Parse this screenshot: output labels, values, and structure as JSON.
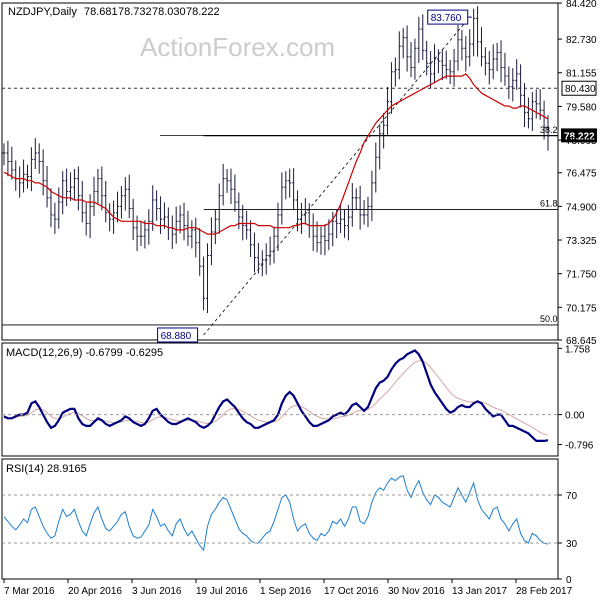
{
  "chart_data": [
    {
      "type": "line",
      "panel": "price",
      "symbol_label": "NZDJPY,Daily",
      "ohlc": [
        "78.681",
        "78.732",
        "78.030",
        "78.222"
      ],
      "watermark": "ActionForex.com",
      "ylim": [
        68.645,
        84.42
      ],
      "y_ticks": [
        "84.420",
        "82.730",
        "81.155",
        "79.580",
        "78.005",
        "76.475",
        "74.900",
        "73.325",
        "71.750",
        "70.175",
        "68.645"
      ],
      "x_tick_labels": [
        "7 Mar 2016",
        "20 Apr 2016",
        "3 Jun 2016",
        "19 Jul 2016",
        "1 Sep 2016",
        "17 Oct 2016",
        "30 Nov 2016",
        "13 Jan 2017",
        "28 Feb 2017"
      ],
      "levels": [
        {
          "name": "high",
          "value": 83.76,
          "label": "83.760"
        },
        {
          "name": "low",
          "value": 68.88,
          "label": "68.880"
        },
        {
          "name": "resistance",
          "value": 80.43,
          "label": "80.430"
        },
        {
          "name": "fib-38.2",
          "value": 78.2,
          "label": "38.2"
        },
        {
          "name": "fib-61.8",
          "value": 74.75,
          "label": "61.8"
        },
        {
          "name": "fib-50.0",
          "value": 69.35,
          "label": "50.0"
        }
      ],
      "last_price": {
        "value": 78.222,
        "label": "78.222"
      },
      "series": [
        {
          "name": "close",
          "color": "#1a1a3a",
          "values": [
            77.4,
            77.0,
            76.6,
            76.2,
            76.0,
            76.4,
            76.3,
            77.1,
            77.4,
            77.0,
            76.1,
            75.3,
            74.5,
            74.3,
            75.1,
            76.1,
            75.6,
            75.8,
            76.2,
            75.4,
            74.6,
            74.1,
            74.9,
            75.6,
            76.2,
            75.4,
            74.6,
            74.3,
            74.6,
            74.9,
            75.4,
            75.7,
            74.8,
            73.9,
            73.5,
            73.5,
            73.8,
            74.2,
            75.2,
            74.8,
            74.3,
            74.4,
            73.9,
            73.6,
            74.2,
            74.5,
            74.0,
            73.5,
            73.8,
            73.2,
            72.1,
            70.6,
            72.6,
            73.7,
            74.3,
            75.4,
            76.2,
            76.1,
            75.7,
            75.1,
            74.4,
            74.0,
            73.8,
            73.1,
            72.5,
            72.2,
            72.4,
            72.6,
            72.8,
            73.5,
            74.5,
            75.8,
            76.1,
            76.0,
            75.2,
            74.3,
            74.5,
            74.6,
            74.0,
            73.5,
            73.2,
            73.5,
            73.3,
            73.6,
            74.2,
            74.1,
            74.3,
            74.0,
            74.4,
            75.3,
            75.3,
            74.5,
            74.5,
            74.9,
            76.0,
            77.2,
            78.3,
            78.7,
            79.8,
            81.2,
            81.3,
            82.4,
            82.8,
            81.9,
            81.4,
            82.3,
            83.2,
            82.2,
            81.6,
            81.1,
            81.8,
            81.7,
            81.5,
            81.3,
            81.2,
            81.7,
            82.7,
            82.3,
            81.9,
            82.5,
            83.7,
            82.6,
            81.9,
            81.6,
            81.3,
            81.8,
            82.1,
            81.4,
            81.0,
            80.5,
            80.8,
            81.1,
            80.1,
            79.3,
            79.0,
            79.8,
            79.7,
            79.4,
            78.6,
            78.2
          ]
        },
        {
          "name": "moving-average",
          "color": "#cc0000",
          "values": [
            76.5,
            76.4,
            76.3,
            76.2,
            76.2,
            76.2,
            76.1,
            76.1,
            76.0,
            76.0,
            75.9,
            75.8,
            75.6,
            75.5,
            75.4,
            75.3,
            75.3,
            75.3,
            75.2,
            75.2,
            75.2,
            75.1,
            75.1,
            75.1,
            75.0,
            74.9,
            74.8,
            74.6,
            74.4,
            74.3,
            74.2,
            74.2,
            74.2,
            74.2,
            74.2,
            74.2,
            74.1,
            74.1,
            74.1,
            74.0,
            74.0,
            74.0,
            73.9,
            73.9,
            73.8,
            73.8,
            73.8,
            73.9,
            73.9,
            73.9,
            73.8,
            73.7,
            73.6,
            73.6,
            73.6,
            73.7,
            73.8,
            73.9,
            74.0,
            74.0,
            74.1,
            74.1,
            74.1,
            74.1,
            74.1,
            74.0,
            74.0,
            74.0,
            74.0,
            73.9,
            73.9,
            73.9,
            73.9,
            73.9,
            74.0,
            74.0,
            74.1,
            74.1,
            74.0,
            74.0,
            74.0,
            74.0,
            74.0,
            74.1,
            74.3,
            74.6,
            75.0,
            75.5,
            76.0,
            76.5,
            77.0,
            77.4,
            77.9,
            78.2,
            78.5,
            78.8,
            79.0,
            79.2,
            79.4,
            79.6,
            79.7,
            79.8,
            79.9,
            80.0,
            80.1,
            80.2,
            80.3,
            80.4,
            80.5,
            80.6,
            80.7,
            80.8,
            80.9,
            81.0,
            81.0,
            81.0,
            81.0,
            81.0,
            81.1,
            80.9,
            80.6,
            80.4,
            80.2,
            80.1,
            80.0,
            79.9,
            79.8,
            79.7,
            79.6,
            79.6,
            79.5,
            79.5,
            79.6,
            79.6,
            79.5,
            79.4,
            79.3,
            79.2,
            79.1,
            79.0
          ]
        }
      ]
    },
    {
      "type": "line",
      "panel": "macd",
      "label": "MACD(12,26,9) -0.6799 -0.6295",
      "ylim": [
        -1.1,
        1.9
      ],
      "y_ticks": [
        "1.758",
        "0.00",
        "-0.796"
      ],
      "series": [
        {
          "name": "macd",
          "color": "#00007f",
          "values": [
            -0.05,
            -0.1,
            -0.1,
            -0.05,
            0.0,
            0.0,
            0.05,
            0.3,
            0.35,
            0.2,
            0.0,
            -0.2,
            -0.35,
            -0.3,
            -0.15,
            0.05,
            0.1,
            0.15,
            0.15,
            -0.1,
            -0.25,
            -0.3,
            -0.3,
            -0.2,
            -0.1,
            -0.15,
            -0.25,
            -0.3,
            -0.25,
            -0.2,
            -0.15,
            -0.05,
            -0.1,
            -0.2,
            -0.25,
            -0.3,
            -0.25,
            -0.1,
            0.1,
            0.15,
            0.0,
            -0.1,
            -0.2,
            -0.25,
            -0.25,
            -0.2,
            -0.15,
            -0.1,
            -0.15,
            -0.2,
            -0.3,
            -0.35,
            -0.3,
            -0.2,
            0.0,
            0.2,
            0.35,
            0.4,
            0.3,
            0.2,
            0.05,
            -0.1,
            -0.2,
            -0.25,
            -0.35,
            -0.35,
            -0.3,
            -0.25,
            -0.2,
            -0.15,
            0.0,
            0.3,
            0.5,
            0.6,
            0.5,
            0.3,
            0.1,
            -0.05,
            -0.2,
            -0.3,
            -0.3,
            -0.25,
            -0.2,
            -0.15,
            -0.05,
            0.0,
            0.05,
            0.0,
            0.1,
            0.25,
            0.3,
            0.2,
            0.1,
            0.2,
            0.45,
            0.7,
            0.85,
            0.9,
            1.0,
            1.2,
            1.35,
            1.45,
            1.5,
            1.6,
            1.65,
            1.7,
            1.6,
            1.4,
            1.1,
            0.8,
            0.6,
            0.45,
            0.3,
            0.15,
            0.05,
            0.1,
            0.2,
            0.25,
            0.2,
            0.2,
            0.3,
            0.35,
            0.3,
            0.15,
            0.05,
            -0.05,
            0.0,
            0.0,
            -0.15,
            -0.3,
            -0.3,
            -0.35,
            -0.4,
            -0.45,
            -0.5,
            -0.6,
            -0.7,
            -0.7,
            -0.7,
            -0.68
          ]
        },
        {
          "name": "signal",
          "color": "#d7a7a7",
          "values": [
            -0.1,
            -0.1,
            -0.1,
            -0.07,
            -0.05,
            -0.04,
            -0.02,
            0.05,
            0.12,
            0.15,
            0.12,
            0.05,
            -0.05,
            -0.1,
            -0.12,
            -0.07,
            -0.02,
            0.03,
            0.06,
            0.03,
            -0.03,
            -0.1,
            -0.15,
            -0.16,
            -0.15,
            -0.15,
            -0.17,
            -0.2,
            -0.21,
            -0.21,
            -0.2,
            -0.16,
            -0.15,
            -0.16,
            -0.18,
            -0.21,
            -0.22,
            -0.2,
            -0.14,
            -0.08,
            -0.06,
            -0.07,
            -0.1,
            -0.13,
            -0.16,
            -0.17,
            -0.17,
            -0.15,
            -0.15,
            -0.16,
            -0.19,
            -0.22,
            -0.24,
            -0.23,
            -0.18,
            -0.1,
            0.0,
            0.1,
            0.15,
            0.16,
            0.14,
            0.09,
            0.03,
            -0.03,
            -0.1,
            -0.15,
            -0.18,
            -0.2,
            -0.2,
            -0.19,
            -0.15,
            -0.06,
            0.06,
            0.17,
            0.23,
            0.24,
            0.21,
            0.16,
            0.09,
            0.01,
            -0.05,
            -0.09,
            -0.11,
            -0.12,
            -0.11,
            -0.09,
            -0.06,
            -0.05,
            -0.02,
            0.03,
            0.09,
            0.11,
            0.11,
            0.13,
            0.2,
            0.3,
            0.41,
            0.51,
            0.61,
            0.73,
            0.86,
            0.98,
            1.09,
            1.2,
            1.3,
            1.39,
            1.43,
            1.42,
            1.36,
            1.25,
            1.12,
            0.99,
            0.86,
            0.72,
            0.59,
            0.49,
            0.43,
            0.39,
            0.36,
            0.33,
            0.33,
            0.33,
            0.33,
            0.3,
            0.25,
            0.19,
            0.15,
            0.12,
            0.07,
            0.0,
            -0.06,
            -0.12,
            -0.17,
            -0.23,
            -0.28,
            -0.34,
            -0.41,
            -0.47,
            -0.52,
            -0.55
          ]
        }
      ]
    },
    {
      "type": "line",
      "panel": "rsi",
      "label": "RSI(14) 28.9165",
      "ylim": [
        0,
        100
      ],
      "y_ticks": [
        "70",
        "30",
        "0"
      ],
      "series": [
        {
          "name": "rsi",
          "color": "#1e7fd2",
          "values": [
            52,
            48,
            44,
            41,
            45,
            50,
            47,
            58,
            60,
            52,
            44,
            38,
            34,
            36,
            48,
            58,
            52,
            54,
            58,
            48,
            40,
            36,
            46,
            55,
            60,
            50,
            42,
            40,
            44,
            48,
            54,
            56,
            44,
            36,
            34,
            35,
            40,
            45,
            58,
            52,
            44,
            46,
            40,
            36,
            46,
            50,
            42,
            36,
            40,
            34,
            28,
            24,
            44,
            54,
            58,
            64,
            68,
            66,
            58,
            50,
            42,
            38,
            36,
            32,
            30,
            30,
            34,
            38,
            40,
            48,
            58,
            68,
            70,
            64,
            50,
            40,
            44,
            46,
            38,
            34,
            32,
            38,
            36,
            40,
            48,
            46,
            50,
            44,
            50,
            60,
            60,
            48,
            46,
            52,
            64,
            72,
            76,
            74,
            80,
            84,
            82,
            85,
            86,
            74,
            68,
            76,
            82,
            72,
            66,
            62,
            70,
            68,
            64,
            62,
            60,
            68,
            76,
            70,
            64,
            72,
            80,
            66,
            58,
            54,
            50,
            58,
            60,
            50,
            46,
            40,
            46,
            50,
            38,
            32,
            30,
            38,
            36,
            32,
            30,
            29
          ]
        }
      ]
    }
  ]
}
